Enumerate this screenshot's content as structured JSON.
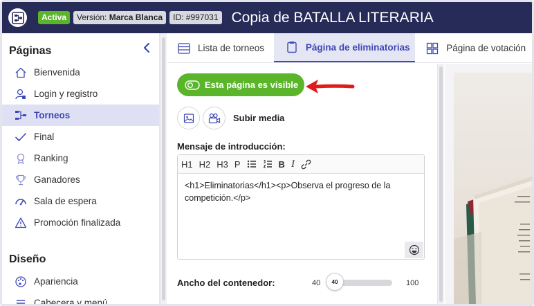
{
  "header": {
    "status_badge": "Activa",
    "version_prefix": "Versión:",
    "version_value": "Marca Blanca",
    "id_label": "ID: #997031",
    "title": "Copia de BATALLA LITERARIA"
  },
  "sidebar": {
    "section_pages": "Páginas",
    "items": [
      {
        "label": "Bienvenida",
        "icon": "home-icon"
      },
      {
        "label": "Login y registro",
        "icon": "user-lock-icon"
      },
      {
        "label": "Torneos",
        "icon": "bracket-icon",
        "active": true
      },
      {
        "label": "Final",
        "icon": "check-icon"
      },
      {
        "label": "Ranking",
        "icon": "medal-icon"
      },
      {
        "label": "Ganadores",
        "icon": "trophy-icon"
      },
      {
        "label": "Sala de espera",
        "icon": "gauge-icon"
      },
      {
        "label": "Promoción finalizada",
        "icon": "warning-icon"
      }
    ],
    "section_design": "Diseño",
    "design_items": [
      {
        "label": "Apariencia",
        "icon": "palette-icon"
      },
      {
        "label": "Cabecera y menú",
        "icon": "menu-icon"
      }
    ]
  },
  "tabs": [
    {
      "label": "Lista de torneos",
      "icon": "list-icon"
    },
    {
      "label": "Página de eliminatorias",
      "icon": "clipboard-icon",
      "active": true
    },
    {
      "label": "Página de votación",
      "icon": "grid-icon"
    }
  ],
  "editor": {
    "visibility_button": "Esta página es visible",
    "upload_media_label": "Subir media",
    "intro_label": "Mensaje de introducción:",
    "toolbar": {
      "h1": "H1",
      "h2": "H2",
      "h3": "H3",
      "p": "P",
      "bold": "B",
      "italic": "I"
    },
    "intro_text": "<h1>Eliminatorias</h1><p>Observa el progreso de la competición.</p>",
    "width_label": "Ancho del contenedor:",
    "width_min": "40",
    "width_max": "100",
    "width_value": "40"
  },
  "colors": {
    "topbar": "#272b57",
    "accent": "#3f48b5",
    "success": "#5ab52b",
    "arrow": "#e01b1b"
  }
}
